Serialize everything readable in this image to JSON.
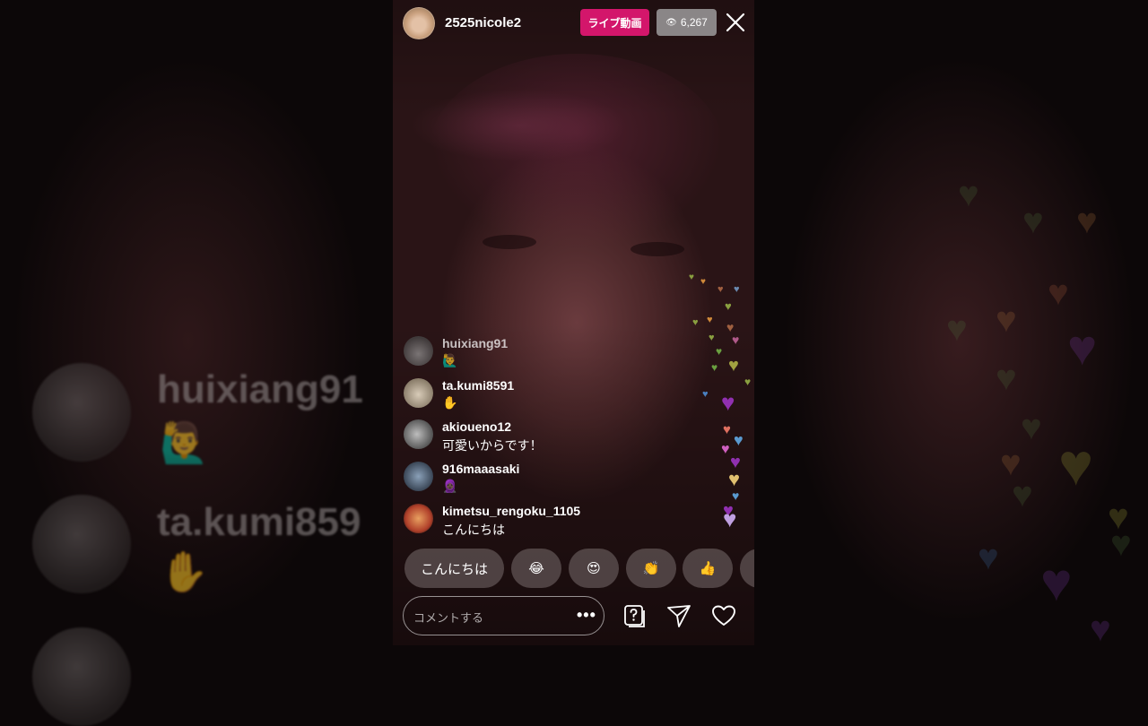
{
  "header": {
    "username": "2525nicole2",
    "live_label": "ライブ動画",
    "viewer_count": "6,267",
    "badge_color": "#d3166b"
  },
  "comments": [
    {
      "username": "huixiang91",
      "text": "🙋‍♂️"
    },
    {
      "username": "ta.kumi8591",
      "text": "✋"
    },
    {
      "username": "akioueno12",
      "text": "可愛いからです！"
    },
    {
      "username": "916maaasaki",
      "text": "🧕🏿"
    },
    {
      "username": "kimetsu_rengoku_1105",
      "text": "こんにちは"
    }
  ],
  "quick_replies": [
    "こんにちは",
    "😂",
    "😍",
    "👏",
    "👍"
  ],
  "input": {
    "placeholder": "コメントする",
    "more": "•••"
  },
  "background_ghost": {
    "names": [
      "huixiang91",
      "ta.kumi859"
    ],
    "emojis": [
      "🙋‍♂️",
      "✋"
    ]
  },
  "icons": [
    "close-icon",
    "question-sticker-icon",
    "send-icon",
    "heart-icon",
    "eye-icon"
  ]
}
